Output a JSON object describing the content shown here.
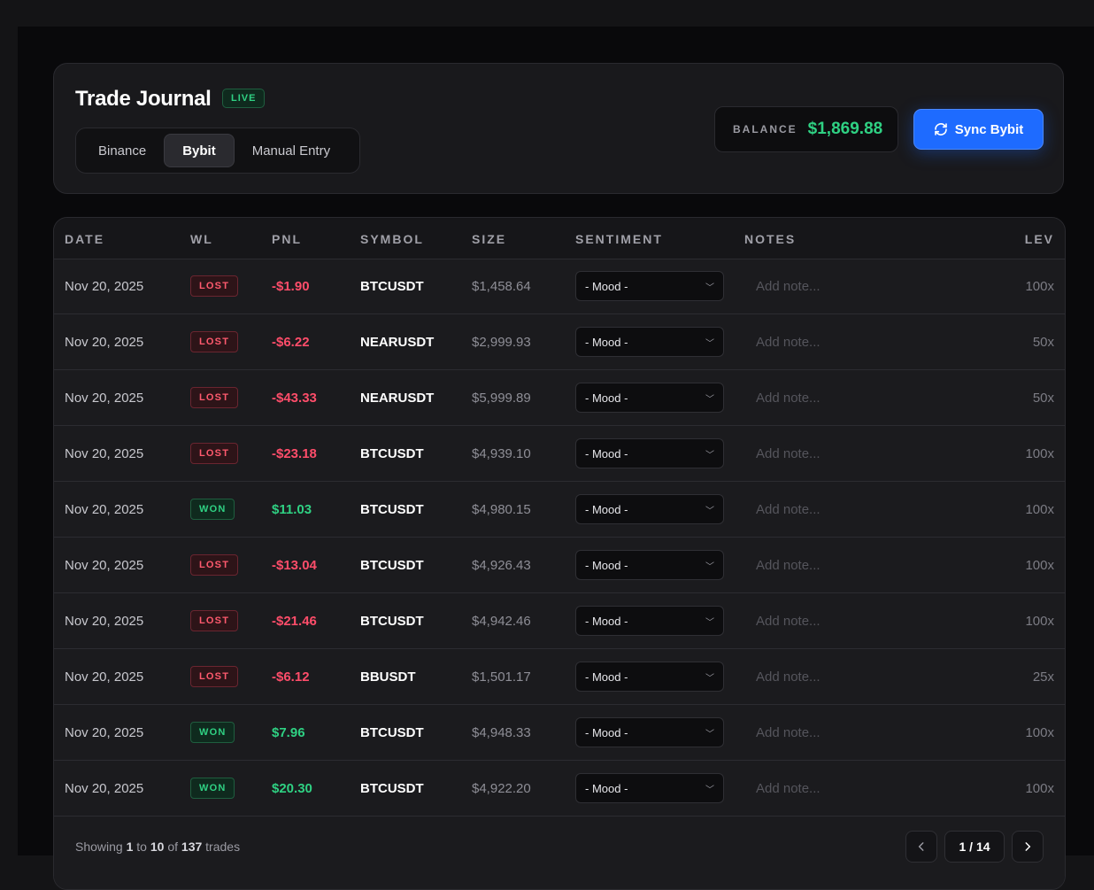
{
  "header": {
    "title": "Trade Journal",
    "live_badge": "LIVE",
    "tabs": [
      {
        "label": "Binance",
        "active": false
      },
      {
        "label": "Bybit",
        "active": true
      },
      {
        "label": "Manual Entry",
        "active": false
      }
    ],
    "balance_label": "BALANCE",
    "balance_value": "$1,869.88",
    "sync_label": "Sync Bybit"
  },
  "table": {
    "columns": [
      "DATE",
      "WL",
      "PNL",
      "SYMBOL",
      "SIZE",
      "SENTIMENT",
      "NOTES",
      "LEV"
    ],
    "rows": [
      {
        "date": "Nov 20, 2025",
        "wl": "LOST",
        "pnl": "-$1.90",
        "symbol": "BTCUSDT",
        "size": "$1,458.64",
        "mood": "- Mood -",
        "note": "Add note...",
        "lev": "100x"
      },
      {
        "date": "Nov 20, 2025",
        "wl": "LOST",
        "pnl": "-$6.22",
        "symbol": "NEARUSDT",
        "size": "$2,999.93",
        "mood": "- Mood -",
        "note": "Add note...",
        "lev": "50x"
      },
      {
        "date": "Nov 20, 2025",
        "wl": "LOST",
        "pnl": "-$43.33",
        "symbol": "NEARUSDT",
        "size": "$5,999.89",
        "mood": "- Mood -",
        "note": "Add note...",
        "lev": "50x"
      },
      {
        "date": "Nov 20, 2025",
        "wl": "LOST",
        "pnl": "-$23.18",
        "symbol": "BTCUSDT",
        "size": "$4,939.10",
        "mood": "- Mood -",
        "note": "Add note...",
        "lev": "100x"
      },
      {
        "date": "Nov 20, 2025",
        "wl": "WON",
        "pnl": "$11.03",
        "symbol": "BTCUSDT",
        "size": "$4,980.15",
        "mood": "- Mood -",
        "note": "Add note...",
        "lev": "100x"
      },
      {
        "date": "Nov 20, 2025",
        "wl": "LOST",
        "pnl": "-$13.04",
        "symbol": "BTCUSDT",
        "size": "$4,926.43",
        "mood": "- Mood -",
        "note": "Add note...",
        "lev": "100x"
      },
      {
        "date": "Nov 20, 2025",
        "wl": "LOST",
        "pnl": "-$21.46",
        "symbol": "BTCUSDT",
        "size": "$4,942.46",
        "mood": "- Mood -",
        "note": "Add note...",
        "lev": "100x"
      },
      {
        "date": "Nov 20, 2025",
        "wl": "LOST",
        "pnl": "-$6.12",
        "symbol": "BBUSDT",
        "size": "$1,501.17",
        "mood": "- Mood -",
        "note": "Add note...",
        "lev": "25x"
      },
      {
        "date": "Nov 20, 2025",
        "wl": "WON",
        "pnl": "$7.96",
        "symbol": "BTCUSDT",
        "size": "$4,948.33",
        "mood": "- Mood -",
        "note": "Add note...",
        "lev": "100x"
      },
      {
        "date": "Nov 20, 2025",
        "wl": "WON",
        "pnl": "$20.30",
        "symbol": "BTCUSDT",
        "size": "$4,922.20",
        "mood": "- Mood -",
        "note": "Add note...",
        "lev": "100x"
      }
    ]
  },
  "footer": {
    "showing_prefix": "Showing",
    "range_start": "1",
    "to_word": "to",
    "range_end": "10",
    "of_word": "of",
    "total": "137",
    "suffix": "trades",
    "page_indicator": "1 / 14"
  },
  "colors": {
    "accent": "#1e6bff",
    "won": "#2fd183",
    "lost": "#ff4d6a",
    "background": "#09090b"
  },
  "icons": {
    "sync": "refresh-icon",
    "prev": "chevron-left-icon",
    "next": "chevron-right-icon",
    "dropdown": "chevron-down-icon"
  }
}
